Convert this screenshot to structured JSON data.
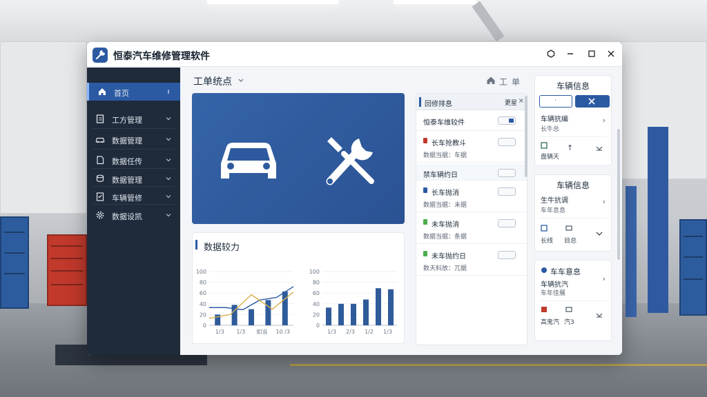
{
  "window": {
    "title": "恒泰汽车维修管理软件"
  },
  "sidebar": {
    "items": [
      {
        "label": "首页",
        "icon": "home-icon",
        "active": true
      },
      {
        "label": "工方管理",
        "icon": "clipboard-icon"
      },
      {
        "label": "数据管理",
        "icon": "car-icon"
      },
      {
        "label": "数据任传",
        "icon": "document-icon"
      },
      {
        "label": "数据管理",
        "icon": "database-icon"
      },
      {
        "label": "车辆管修",
        "icon": "checklist-icon"
      },
      {
        "label": "数据设凯",
        "icon": "gear-icon"
      }
    ]
  },
  "header": {
    "title": "工单统点",
    "breadcrumb": "工单"
  },
  "hero": {
    "icons": [
      "car-icon",
      "wrench-screwdriver-icon"
    ]
  },
  "chart_section": {
    "title": "数据较力"
  },
  "chart_data": [
    {
      "type": "bar",
      "categories": [
        "1/3",
        "1/3",
        "1/3",
        "1/3"
      ],
      "x_ticks": [
        "1/3",
        "1/3",
        "如当",
        "10 /3"
      ],
      "y_ticks": [
        "0",
        "20",
        "40",
        "60",
        "80",
        "100"
      ],
      "ylim": [
        0,
        100
      ],
      "series": [
        {
          "values": [
            20,
            38,
            30,
            47,
            63
          ]
        }
      ],
      "overlay_lines": [
        {
          "color": "#2b5aa3",
          "values": [
            33,
            33,
            29,
            47,
            52,
            72
          ]
        },
        {
          "color": "#d9b04a",
          "values": [
            13,
            20,
            57,
            30,
            62
          ]
        }
      ]
    },
    {
      "type": "bar",
      "x_ticks": [
        "1/3",
        "2/3",
        "1/2",
        "1/3"
      ],
      "y_ticks": [
        "0",
        "20",
        "40",
        "60",
        "80",
        "100"
      ],
      "ylim": [
        0,
        100
      ],
      "series": [
        {
          "values": [
            33,
            40,
            40,
            48,
            69,
            67
          ]
        }
      ]
    }
  ],
  "work_list": {
    "header": "回修排息",
    "header_right": "更星",
    "rows": [
      {
        "title": "恒泰车维较件",
        "toggle": true
      },
      {
        "title": "长车抢教斗",
        "sub": "数据当据：车据",
        "color": "#c0392b",
        "toggle": false
      },
      {
        "title": "禁车辆约日",
        "toggle": false,
        "highlight": true
      },
      {
        "title": "长车抛消",
        "sub": "数据当据：未据",
        "color": "#2b5aa3",
        "toggle": false
      },
      {
        "title": "未车抛消",
        "sub": "数据当据：条据",
        "color": "#4caf50",
        "toggle": false
      },
      {
        "title": "未车抛约日",
        "sub": "数天料放：兀据",
        "color": "#4caf50",
        "toggle": false
      }
    ]
  },
  "vehicle_panel": {
    "title": "车辆信息",
    "cards": [
      {
        "header": "车辆信息",
        "item_title": "车辆抗编",
        "item_sub": "长牛总",
        "mini": [
          "盘辆天"
        ]
      },
      {
        "header": "车辆信息",
        "item_title": "生牛抗调",
        "item_sub": "车年息息",
        "mini": [
          "长线",
          "目总"
        ]
      },
      {
        "header": "车车意息",
        "item_title": "车辆抗汽",
        "item_sub": "车年佳展",
        "mini": [
          "高鬼汽",
          "汽3"
        ]
      }
    ]
  },
  "colors": {
    "accent": "#2b5aa3",
    "sidebar_bg": "#1f2a3a",
    "line_gold": "#d9b04a"
  }
}
